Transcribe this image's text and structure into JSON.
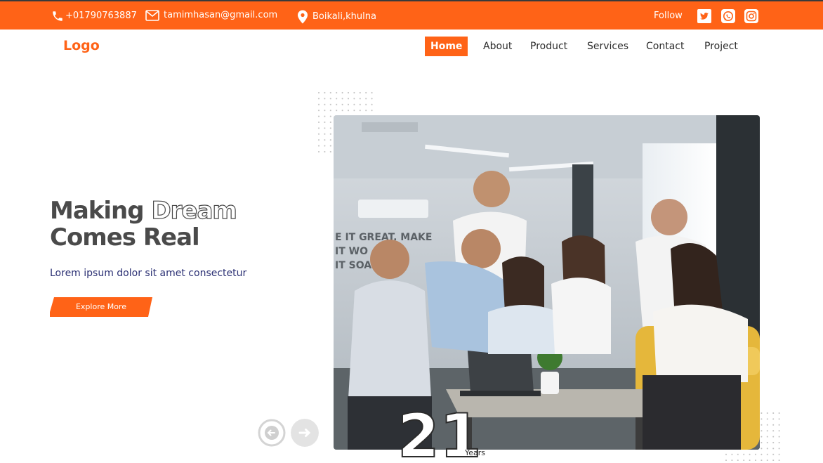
{
  "topbar": {
    "phone": "+01790763887",
    "email": "tamimhasan@gmail.com",
    "location": "Boikali,khulna",
    "follow_label": "Follow",
    "social_icons": [
      "twitter-icon",
      "whatsapp-icon",
      "instagram-icon"
    ]
  },
  "nav": {
    "logo": "Logo",
    "items": [
      "Home",
      "About",
      "Product",
      "Services",
      "Contact",
      "Project"
    ],
    "active": "Home"
  },
  "hero": {
    "title_word1": "Making",
    "title_word2": "Dream",
    "title_line2": "Comes Real",
    "subtitle": "Lorem ipsum dolor sit amet consectetur",
    "cta": "Explore More",
    "years_number": "21",
    "years_label": "Years"
  },
  "colors": {
    "accent": "#ff6317",
    "heading": "#4a4a4a",
    "subtitle": "#2a2f73"
  }
}
